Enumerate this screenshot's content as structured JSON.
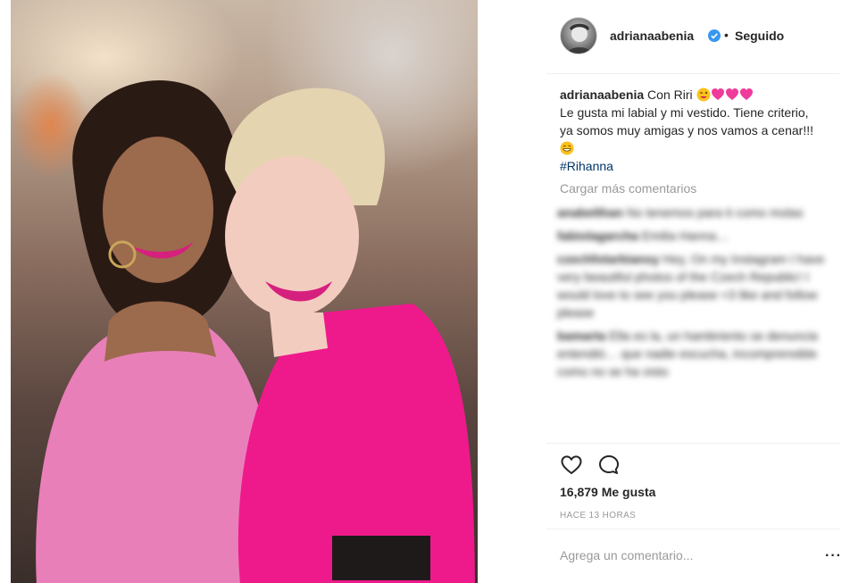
{
  "post": {
    "username": "adrianaabenia",
    "follow_status": "Seguido",
    "separator": "•",
    "caption_user": "adrianaabenia",
    "caption_line1": "Con Riri",
    "caption_body": "Le gusta mi labial y mi vestido. Tiene criterio, ya somos muy amigas y nos vamos a cenar!!!",
    "hashtag": "#Rihanna",
    "load_more": "Cargar más comentarios",
    "likes": "16,879 Me gusta",
    "time": "HACE 13 HORAS",
    "comment_placeholder": "Agrega un comentario...",
    "more_options": "···"
  },
  "comments": [
    {
      "user": "anabelthan",
      "text": "No tenemos para ti como molas"
    },
    {
      "user": "fabiolagarcha",
      "text": "Emilia Hanna…"
    },
    {
      "user": "czechfotarbiansy",
      "text": "Hey, On my Instagram I have very beautiful photos of the Czech Republic! I would love to see you please <3 like and follow please"
    },
    {
      "user": "bamarta",
      "text": "Ella es la, un hambriento se denuncia entendió… que nadie escucha, incomprensible como no se ha visto"
    }
  ],
  "icons": [
    "heart-icon",
    "comment-icon",
    "verified-badge-icon",
    "emoji-wink-icon",
    "emoji-heart-icon",
    "emoji-grin-icon"
  ],
  "colors": {
    "text": "#262626",
    "muted": "#999999",
    "hashtag": "#003569",
    "verified": "#3897f0",
    "divider": "#efefef"
  }
}
